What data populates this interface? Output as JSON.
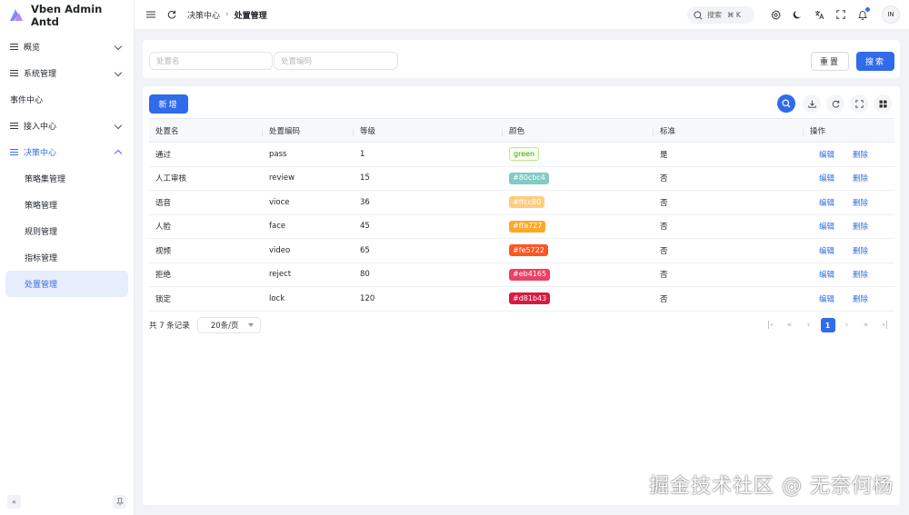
{
  "app": {
    "title": "Vben Admin Antd"
  },
  "sidebar": {
    "items": [
      {
        "label": "概览",
        "has_chevron": true
      },
      {
        "label": "系统管理",
        "has_chevron": true
      },
      {
        "label": "事件中心",
        "has_chevron": false
      },
      {
        "label": "接入中心",
        "has_chevron": true
      },
      {
        "label": "决策中心",
        "has_chevron": true,
        "expanded": true
      }
    ],
    "subitems": [
      {
        "label": "策略集管理"
      },
      {
        "label": "策略管理"
      },
      {
        "label": "规则管理"
      },
      {
        "label": "指标管理"
      },
      {
        "label": "处置管理",
        "selected": true
      }
    ],
    "footer": {
      "collapse_icon": "«",
      "pin_icon": "pin"
    }
  },
  "header": {
    "breadcrumb": [
      "决策中心",
      "处置管理"
    ],
    "search": {
      "label": "搜索",
      "shortcut": "⌘ K"
    },
    "avatar": "IN"
  },
  "filters": {
    "name_placeholder": "处置名",
    "code_placeholder": "处置编码",
    "reset_label": "重置",
    "search_label": "搜索"
  },
  "toolbar": {
    "add_label": "新增"
  },
  "table": {
    "columns": [
      "处置名",
      "处置编码",
      "等级",
      "颜色",
      "标准",
      "操作"
    ],
    "rows": [
      {
        "name": "通过",
        "code": "pass",
        "level": "1",
        "color": "green",
        "color_hex": "#f6ffed",
        "standard": "是"
      },
      {
        "name": "人工审核",
        "code": "review",
        "level": "15",
        "color": "#80cbc4",
        "color_hex": "#80cbc4",
        "standard": "否"
      },
      {
        "name": "语音",
        "code": "vioce",
        "level": "36",
        "color": "#ffcc80",
        "color_hex": "#ffcc80",
        "standard": "否"
      },
      {
        "name": "人脸",
        "code": "face",
        "level": "45",
        "color": "#ffa727",
        "color_hex": "#ffa727",
        "standard": "否"
      },
      {
        "name": "视频",
        "code": "video",
        "level": "65",
        "color": "#fe5722",
        "color_hex": "#fe5722",
        "standard": "否"
      },
      {
        "name": "拒绝",
        "code": "reject",
        "level": "80",
        "color": "#eb4165",
        "color_hex": "#eb4165",
        "standard": "否"
      },
      {
        "name": "锁定",
        "code": "lock",
        "level": "120",
        "color": "#d81b43",
        "color_hex": "#d81b43",
        "standard": "否"
      }
    ],
    "actions": {
      "edit": "编辑",
      "delete": "删除"
    }
  },
  "pagination": {
    "total_text": "共 7 条记录",
    "page_size": "20条/页",
    "current_page": "1"
  },
  "watermark": "掘金技术社区 @ 无奈何杨",
  "colors": {
    "primary": "#2f6bea",
    "selected_bg": "#e6edfc"
  }
}
